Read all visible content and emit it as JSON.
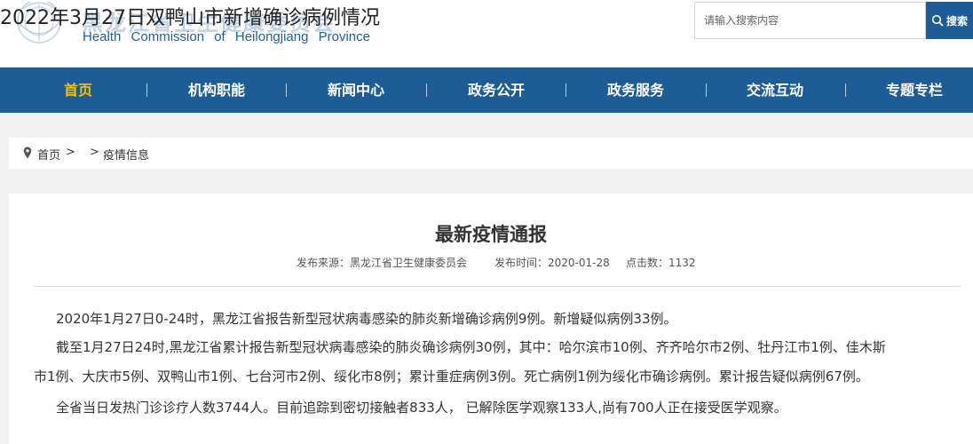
{
  "header": {
    "logo_cn": "黑龙江省卫生健康委员会",
    "logo_en": "Health Commission of Heilongjiang Province",
    "overlay_title": "2022年3月27日双鸭山市新增确诊病例情况"
  },
  "search": {
    "placeholder": "请输入搜索内容",
    "button_label": "搜索",
    "icon": "search-icon"
  },
  "nav": {
    "items": [
      {
        "label": "首页",
        "active": true
      },
      {
        "label": "机构职能"
      },
      {
        "label": "新闻中心"
      },
      {
        "label": "政务公开"
      },
      {
        "label": "政务服务"
      },
      {
        "label": "交流互动"
      },
      {
        "label": "专题专栏"
      }
    ]
  },
  "breadcrumb": {
    "icon": "location-pin-icon",
    "home": "首页",
    "sep1": ">",
    "sep2": ">",
    "current": "疫情信息"
  },
  "article": {
    "title": "最新疫情通报",
    "source_label": "发布来源：黑龙江省卫生健康委员会",
    "time_label": "发布时间：2020-01-28",
    "clicks_label": "点击数：1132",
    "paragraphs": [
      "2020年1月27日0-24时，黑龙江省报告新型冠状病毒感染的肺炎新增确诊病例9例。新增疑似病例33例。",
      "截至1月27日24时,黑龙江省累计报告新型冠状病毒感染的肺炎确诊病例30例，其中：哈尔滨市10例、齐齐哈尔市2例、牡丹江市1例、佳木斯",
      "市1例、大庆市5例、双鸭山市1例、七台河市2例、绥化市8例；累计重症病例3例。死亡病例1例为绥化市确诊病例。累计报告疑似病例67例。",
      "全省当日发热门诊诊疗人数3744人。目前追踪到密切接触者833人， 已解除医学观察133人,尚有700人正在接受医学观察。"
    ]
  },
  "colors": {
    "nav_bg": "#1d5c94",
    "nav_active": "#f5c200",
    "brand_blue": "#1f5f9e"
  }
}
